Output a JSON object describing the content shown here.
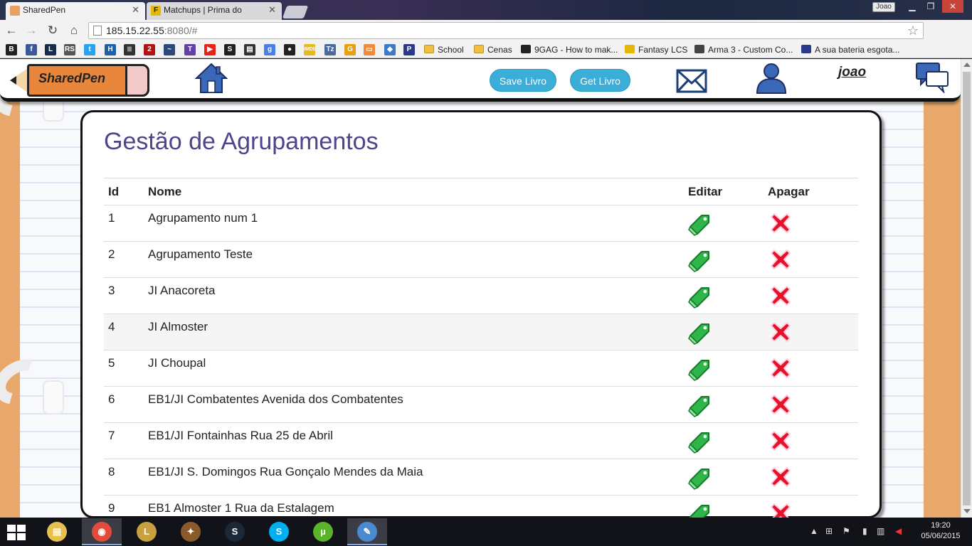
{
  "browser": {
    "tabs": [
      {
        "label": "SharedPen",
        "active": true
      },
      {
        "label": "Matchups | Prima do Umb",
        "active": false
      }
    ],
    "window_user": "Joao",
    "url_host": "185.15.22.55",
    "url_rest": ":8080/#",
    "bookmark_icons": [
      {
        "icon": "blogger-icon",
        "glyph": "B",
        "color": "#222222"
      },
      {
        "icon": "facebook-icon",
        "glyph": "f",
        "color": "#3b5998"
      },
      {
        "icon": "l-icon",
        "glyph": "L",
        "color": "#1a2a4a"
      },
      {
        "icon": "rs-icon",
        "glyph": "RS",
        "color": "#555555"
      },
      {
        "icon": "twitter-icon",
        "glyph": "t",
        "color": "#2aa3ef"
      },
      {
        "icon": "h-icon",
        "glyph": "H",
        "color": "#1f5fa8"
      },
      {
        "icon": "bars-icon",
        "glyph": "|||",
        "color": "#333333"
      },
      {
        "icon": "two-icon",
        "glyph": "2",
        "color": "#b01515"
      },
      {
        "icon": "leaf-icon",
        "glyph": "~",
        "color": "#2a4a7a"
      },
      {
        "icon": "twitch-icon",
        "glyph": "T",
        "color": "#6441a5"
      },
      {
        "icon": "youtube-icon",
        "glyph": "▶",
        "color": "#e62117"
      },
      {
        "icon": "s-icon",
        "glyph": "S",
        "color": "#222222"
      },
      {
        "icon": "print-icon",
        "glyph": "▤",
        "color": "#333333"
      },
      {
        "icon": "google-icon",
        "glyph": "g",
        "color": "#4a7fe6"
      },
      {
        "icon": "record-icon",
        "glyph": "●",
        "color": "#222222"
      },
      {
        "icon": "imdb-icon",
        "glyph": "IMDb",
        "color": "#e6b91e"
      },
      {
        "icon": "tz-icon",
        "glyph": "Tz",
        "color": "#4a6a9a"
      },
      {
        "icon": "g-yellow-icon",
        "glyph": "G",
        "color": "#e8a010"
      },
      {
        "icon": "chat-bubble-icon",
        "glyph": "▭",
        "color": "#f08a3a"
      },
      {
        "icon": "shield-icon",
        "glyph": "◆",
        "color": "#3a7ac8"
      },
      {
        "icon": "p-icon",
        "glyph": "P",
        "color": "#2a3a8a"
      }
    ],
    "bookmark_links": [
      {
        "label": "School",
        "icon": "folder-icon"
      },
      {
        "label": "Cenas",
        "icon": "folder-icon"
      },
      {
        "label": "9GAG - How to mak...",
        "icon": "9gag-icon"
      },
      {
        "label": "Fantasy LCS",
        "icon": "fantasy-icon"
      },
      {
        "label": "Arma 3 - Custom Co...",
        "icon": "arma-icon"
      },
      {
        "label": "A sua bateria esgota...",
        "icon": "p-icon"
      }
    ]
  },
  "app": {
    "logo_text": "SharedPen",
    "buttons": {
      "save": "Save Livro",
      "get": "Get Livro"
    },
    "username": "joao",
    "colors": {
      "accent": "#3aaed8",
      "title": "#4d4589",
      "pencil": "#e8873b",
      "edit": "#2fb64a",
      "delete": "#e8112d"
    }
  },
  "page": {
    "title": "Gestão de Agrupamentos",
    "columns": {
      "id": "Id",
      "nome": "Nome",
      "editar": "Editar",
      "apagar": "Apagar"
    },
    "rows": [
      {
        "id": "1",
        "nome": "Agrupamento num 1"
      },
      {
        "id": "2",
        "nome": "Agrupamento Teste"
      },
      {
        "id": "3",
        "nome": "JI Anacoreta"
      },
      {
        "id": "4",
        "nome": "JI Almoster"
      },
      {
        "id": "5",
        "nome": "JI Choupal"
      },
      {
        "id": "6",
        "nome": "EB1/JI Combatentes Avenida dos Combatentes"
      },
      {
        "id": "7",
        "nome": "EB1/JI Fontainhas Rua 25 de Abril"
      },
      {
        "id": "8",
        "nome": "EB1/JI S. Domingos Rua Gonçalo Mendes da Maia"
      },
      {
        "id": "9",
        "nome": "EB1 Almoster 1 Rua da Estalagem"
      }
    ],
    "highlighted_row": "4"
  },
  "taskbar": {
    "apps": [
      {
        "name": "file-explorer",
        "glyph": "▤",
        "color": "#e8c050"
      },
      {
        "name": "chrome",
        "glyph": "◉",
        "color": "#e24a3a"
      },
      {
        "name": "league-of-legends",
        "glyph": "L",
        "color": "#c8a040"
      },
      {
        "name": "hearthstone",
        "glyph": "✦",
        "color": "#8a5a2a"
      },
      {
        "name": "steam",
        "glyph": "S",
        "color": "#1b2838"
      },
      {
        "name": "skype",
        "glyph": "S",
        "color": "#00aff0"
      },
      {
        "name": "utorrent",
        "glyph": "µ",
        "color": "#5ab42a"
      },
      {
        "name": "paint",
        "glyph": "✎",
        "color": "#4a8ad0"
      }
    ],
    "time": "19:20",
    "date": "05/06/2015"
  }
}
